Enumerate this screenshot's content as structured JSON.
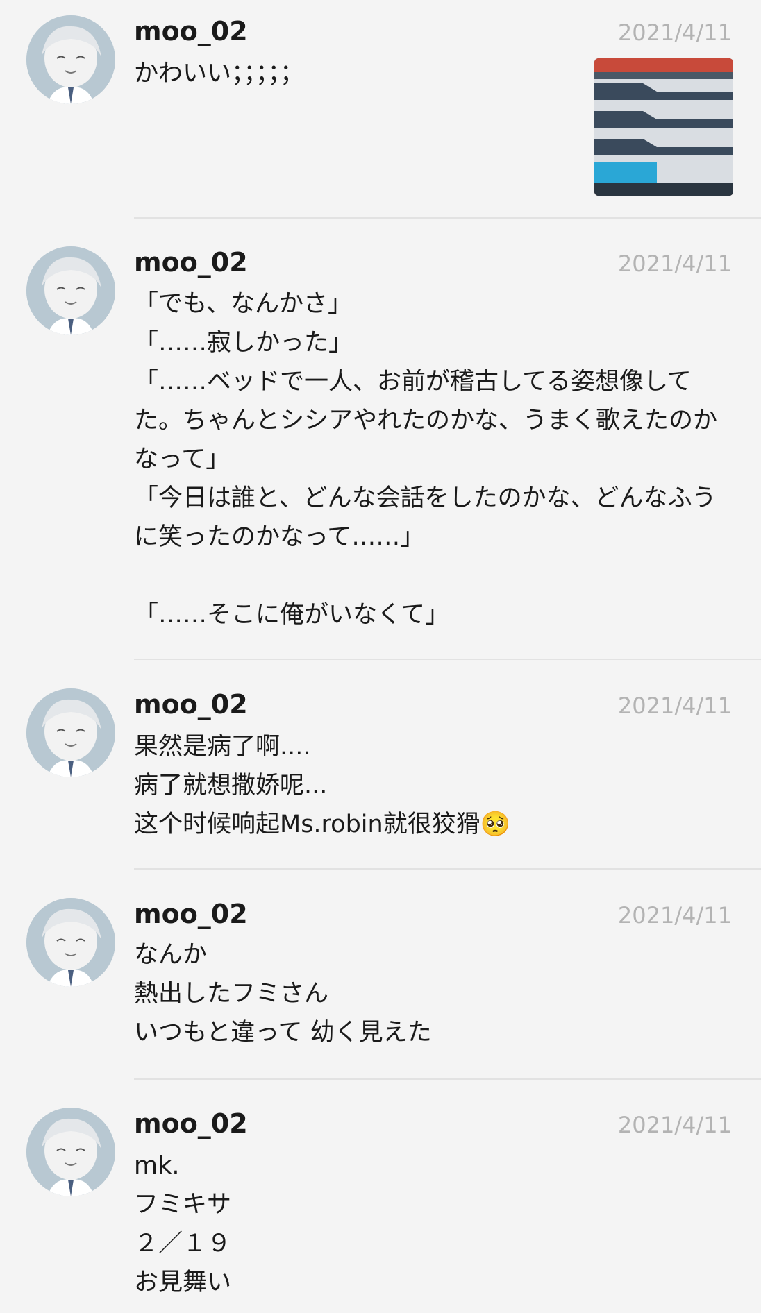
{
  "posts": [
    {
      "user": "moo_02",
      "date": "2021/4/11",
      "text": "かわいい；；；；；",
      "has_image": true
    },
    {
      "user": "moo_02",
      "date": "2021/4/11",
      "text": "「でも、なんかさ」\n「……寂しかった」\n「……ベッドで一人、お前が稽古してる姿想像してた。ちゃんとシシアやれたのかな、うまく歌えたのかなって」\n「今日は誰と、どんな会話をしたのかな、どんなふうに笑ったのかなって……」\n\n「……そこに俺がいなくて」"
    },
    {
      "user": "moo_02",
      "date": "2021/4/11",
      "text": "果然是病了啊....\n病了就想撒娇呢...\n这个时候响起Ms.robin就很狡猾🥺"
    },
    {
      "user": "moo_02",
      "date": "2021/4/11",
      "text": "なんか\n熱出したフミさん\nいつもと違って 幼く見えた"
    },
    {
      "user": "moo_02",
      "date": "2021/4/11",
      "text": "mk.\nフミキサ\n２／１９\nお見舞い"
    }
  ],
  "colors": {
    "background": "#f4f4f4",
    "text": "#1a1a1a",
    "timestamp": "#b3b3b3",
    "divider": "#e2e2e2"
  },
  "icons": {
    "avatar": "avatar-illustration",
    "attachment": "image-thumbnail"
  }
}
